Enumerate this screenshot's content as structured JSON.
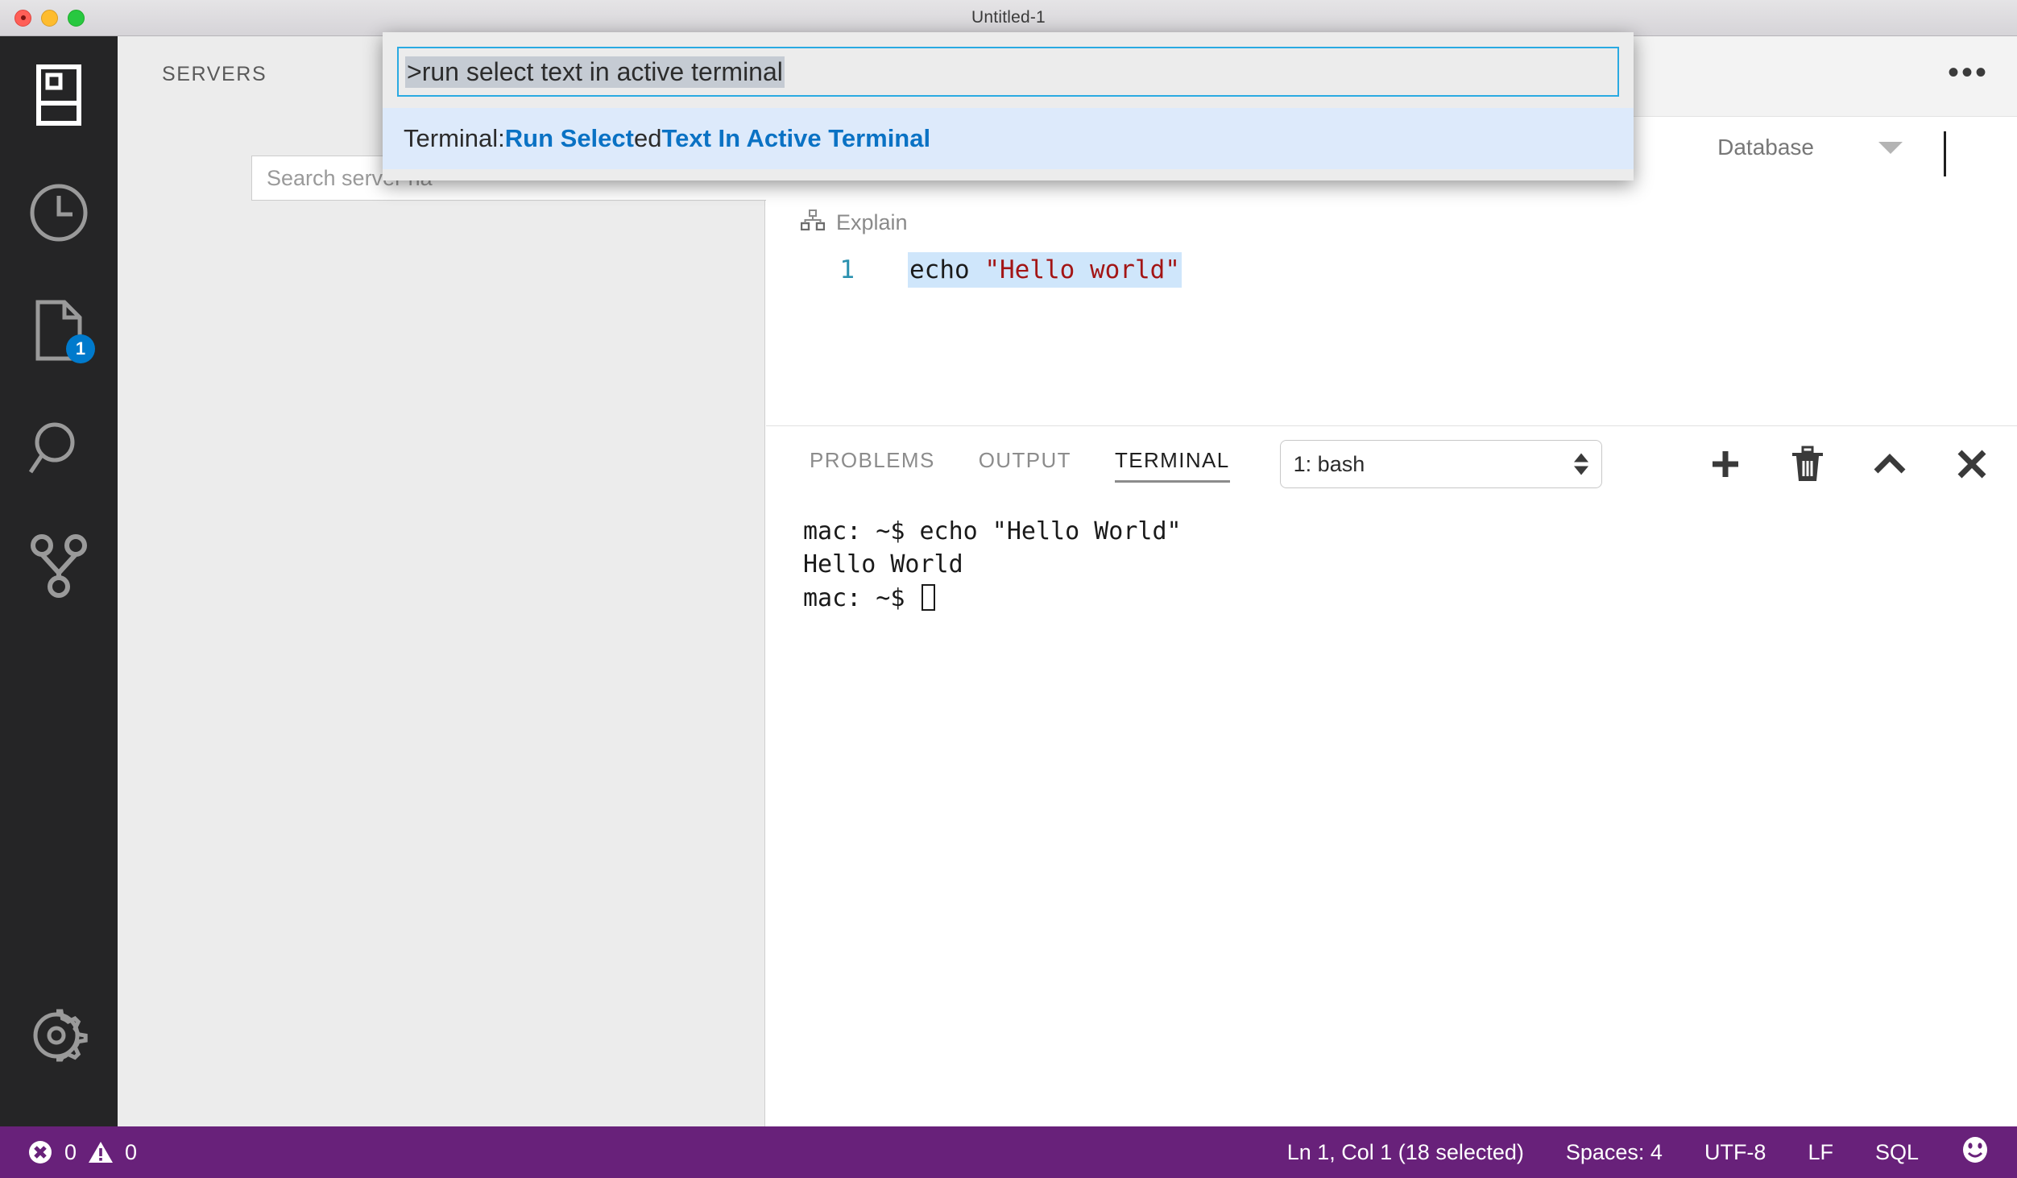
{
  "window": {
    "title": "Untitled-1",
    "traffic_lights": [
      "close",
      "minimize",
      "zoom"
    ]
  },
  "activity_bar": {
    "items": [
      {
        "name": "servers-icon",
        "label": "Servers",
        "badge": null
      },
      {
        "name": "history-icon",
        "label": "History",
        "badge": null
      },
      {
        "name": "file-icon",
        "label": "Open Editors",
        "badge": "1"
      },
      {
        "name": "search-icon",
        "label": "Search",
        "badge": null
      },
      {
        "name": "source-control-icon",
        "label": "Source Control",
        "badge": null
      }
    ],
    "settings": {
      "name": "gear-icon",
      "label": "Manage"
    }
  },
  "sidebar": {
    "title": "SERVERS",
    "search_placeholder": "Search server na"
  },
  "editor": {
    "more_actions_label": "•••",
    "database_dropdown": "Database",
    "explain_label": "Explain",
    "line_number": "1",
    "code": {
      "command": "echo ",
      "string": "\"Hello world\""
    }
  },
  "quick_open": {
    "input_value": ">run select text in active terminal",
    "results": [
      {
        "prefix": "Terminal: ",
        "segments": [
          {
            "text": "Run Select",
            "highlight": true
          },
          {
            "text": "ed ",
            "highlight": false
          },
          {
            "text": "Text In Active Terminal",
            "highlight": true
          }
        ],
        "selected": true
      }
    ]
  },
  "panel": {
    "tabs": [
      {
        "label": "PROBLEMS",
        "active": false
      },
      {
        "label": "OUTPUT",
        "active": false
      },
      {
        "label": "TERMINAL",
        "active": true
      }
    ],
    "terminal_select": "1: bash",
    "actions": [
      {
        "name": "add-terminal-button",
        "icon": "plus-icon"
      },
      {
        "name": "kill-terminal-button",
        "icon": "trash-icon"
      },
      {
        "name": "maximize-panel-button",
        "icon": "chevron-up-icon"
      },
      {
        "name": "close-panel-button",
        "icon": "close-icon"
      }
    ],
    "terminal_lines": [
      "mac: ~$ echo \"Hello World\"",
      "Hello World",
      "mac: ~$ "
    ]
  },
  "status_bar": {
    "errors": "0",
    "warnings": "0",
    "cursor_position": "Ln 1, Col 1 (18 selected)",
    "indentation": "Spaces: 4",
    "encoding": "UTF-8",
    "eol": "LF",
    "language": "SQL",
    "feedback_icon": "smiley-icon"
  },
  "colors": {
    "status_bar_bg": "#68217a",
    "accent_blue": "#007acc",
    "highlight_blue": "#0a72c4",
    "selection_blue": "#cfe6fb",
    "activity_bar_bg": "#252526",
    "string_red": "#a31515",
    "gutter_teal": "#2b91af"
  }
}
